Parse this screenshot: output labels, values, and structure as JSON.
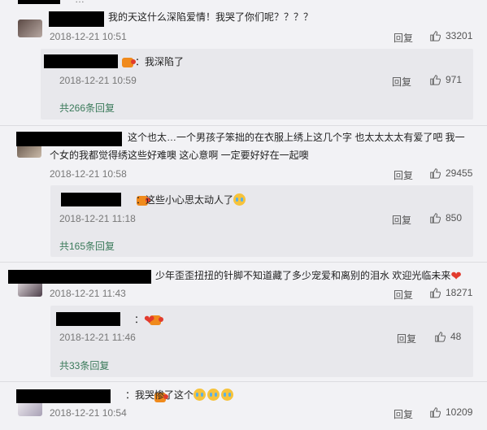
{
  "top_partial": "…",
  "comments": [
    {
      "text": "我的天这什么深陷爱情！我哭了你们呢？？？？",
      "time": "2018-12-21 10:51",
      "reply_label": "回复",
      "likes": "33201",
      "subreply": {
        "text": "我深陷了",
        "time": "2018-12-21 10:59",
        "reply_label": "回复",
        "likes": "971"
      },
      "more": "共266条回复"
    },
    {
      "text_line1": "这个也太…一个男孩子笨拙的在衣服上绣上这几个字 也太太太太有爱了吧 我一",
      "text_line2": "个女的我都觉得绣这些好难噢 这心意啊 一定要好好在一起噢",
      "time": "2018-12-21 10:58",
      "reply_label": "回复",
      "likes": "29455",
      "subreply": {
        "text": "这些小心思太动人了",
        "time": "2018-12-21 11:18",
        "reply_label": "回复",
        "likes": "850"
      },
      "more": "共165条回复"
    },
    {
      "text": "少年歪歪扭扭的针脚不知道藏了多少宠爱和离别的泪水 欢迎光临未来",
      "time": "2018-12-21 11:43",
      "reply_label": "回复",
      "likes": "18271",
      "subreply": {
        "text": "",
        "time": "2018-12-21 11:46",
        "reply_label": "回复",
        "likes": "48"
      },
      "more": "共33条回复"
    },
    {
      "text": "我哭惨了这个",
      "time": "2018-12-21 10:54",
      "reply_label": "回复",
      "likes": "10209"
    }
  ],
  "icons": {
    "like": "thumbs-up-icon",
    "emoji_cry": "crying-face-emoji",
    "heart": "red-heart-emoji",
    "badge": "user-badge-icon"
  }
}
